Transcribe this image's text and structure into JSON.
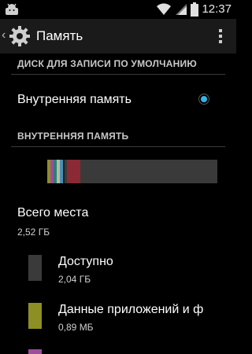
{
  "status_bar": {
    "time": "12:37"
  },
  "action_bar": {
    "title": "Память",
    "icon": "settings-gear-icon"
  },
  "sections": {
    "default_disk_header": "ДИСК ДЛЯ ЗАПИСИ ПО УМОЛЧАНИЮ",
    "internal_memory_header": "ВНУТРЕННЯЯ ПАМЯТЬ"
  },
  "default_disk": {
    "option_label": "Внутренняя память",
    "selected": true,
    "radio_color": "#33b5e5"
  },
  "usage_bar": {
    "background": "#3a3a3a",
    "segments": [
      {
        "color": "#8d8f24",
        "fraction": 0.0185
      },
      {
        "color": "#9b4e99",
        "fraction": 0.0185
      },
      {
        "color": "#2b7e7c",
        "fraction": 0.0185
      },
      {
        "color": "#b6bd9d",
        "fraction": 0.0185
      },
      {
        "color": "#4b8fb4",
        "fraction": 0.0185
      },
      {
        "color": "#1f1f1f",
        "fraction": 0.0093
      },
      {
        "color": "#3a3a3a",
        "fraction": 0.0139
      },
      {
        "color": "#8b2a34",
        "fraction": 0.0787
      }
    ]
  },
  "total": {
    "label": "Всего места",
    "value": "2,52 ГБ"
  },
  "items": [
    {
      "label": "Доступно",
      "value": "2,04 ГБ",
      "color": "#3a3a3a"
    },
    {
      "label": "Данные приложений и ф",
      "value": "0,89 МБ",
      "color": "#8d8f24"
    },
    {
      "label": "",
      "value": "",
      "color": "#9b4e99"
    }
  ]
}
